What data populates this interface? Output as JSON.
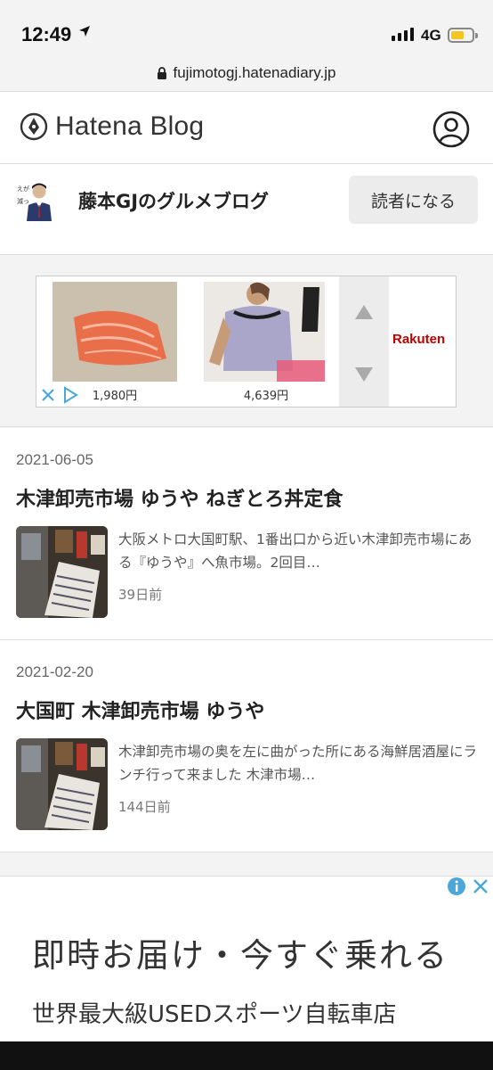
{
  "status": {
    "time": "12:49",
    "network": "4G"
  },
  "browser": {
    "url": "fujimotogj.hatenadiary.jp"
  },
  "header": {
    "logo_text": "Hatena Blog"
  },
  "blog": {
    "title": "藤本GJのグルメブログ",
    "subscribe_label": "読者になる"
  },
  "ad_banner": {
    "items": [
      {
        "price": "1,980円"
      },
      {
        "price": "4,639円"
      }
    ],
    "brand": "Rakuten"
  },
  "articles": [
    {
      "date": "2021-06-05",
      "title": "木津卸売市場 ゆうや ねぎとろ丼定食",
      "excerpt": "大阪メトロ大国町駅、1番出口から近い木津卸売市場にある『ゆうや』へ魚市場。2回目…",
      "ago": "39日前"
    },
    {
      "date": "2021-02-20",
      "title": "大国町 木津卸売市場 ゆうや",
      "excerpt": "木津卸売市場の奥を左に曲がった所にある海鮮居酒屋にランチ行って来ました 木津市場…",
      "ago": "144日前"
    }
  ],
  "bottom_ad": {
    "headline": "即時お届け・今すぐ乗れる",
    "subline": "世界最大級USEDスポーツ自転車店"
  },
  "colors": {
    "accent_red": "#bf0000",
    "ad_icon_blue": "#4aa8d8"
  }
}
